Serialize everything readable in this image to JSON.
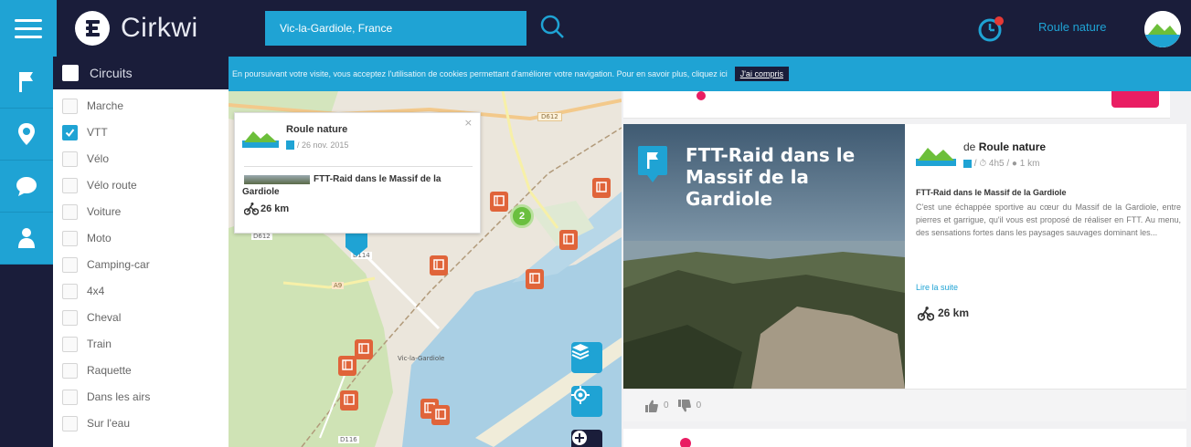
{
  "header": {
    "logo_text": "Cirkwi",
    "search": {
      "value": "Vic-la-Gardiole, France"
    },
    "username": "Roule nature"
  },
  "rail": {
    "items": [
      {
        "icon": "flag-icon"
      },
      {
        "icon": "map-pin-icon"
      },
      {
        "icon": "chat-bubble-icon"
      },
      {
        "icon": "user-icon"
      }
    ]
  },
  "filters": {
    "heading": "Circuits",
    "items": [
      {
        "label": "Marche",
        "checked": false
      },
      {
        "label": "VTT",
        "checked": true
      },
      {
        "label": "Vélo",
        "checked": false
      },
      {
        "label": "Vélo route",
        "checked": false
      },
      {
        "label": "Voiture",
        "checked": false
      },
      {
        "label": "Moto",
        "checked": false
      },
      {
        "label": "Camping-car",
        "checked": false
      },
      {
        "label": "4x4",
        "checked": false
      },
      {
        "label": "Cheval",
        "checked": false
      },
      {
        "label": "Train",
        "checked": false
      },
      {
        "label": "Raquette",
        "checked": false
      },
      {
        "label": "Dans les airs",
        "checked": false
      },
      {
        "label": "Sur l'eau",
        "checked": false
      }
    ]
  },
  "cookie": {
    "text": "En poursuivant votre visite, vous acceptez l'utilisation de cookies permettant d'améliorer votre navigation. Pour en savoir plus, cliquez ici",
    "button": "J'ai compris"
  },
  "map": {
    "cluster_count": "2",
    "place_label": "Vic-la-Gardiole",
    "road_labels": [
      "D612",
      "D114",
      "A9",
      "D612",
      "D116"
    ],
    "popup": {
      "close": "×",
      "author": "Roule nature",
      "date": "/ 26 nov. 2015",
      "title": "FTT-Raid dans le Massif de la Gardiole",
      "distance": "26 km"
    }
  },
  "card": {
    "photo_title": "FTT-Raid dans le Massif de la Gardiole",
    "author_prefix": "de",
    "author": "Roule nature",
    "meta": "/ ⏱ 4h5 / ● 1 km",
    "title": "FTT-Raid dans le Massif de la Gardiole",
    "description": "C'est une échappée sportive au cœur du Massif de la Gardiole, entre pierres et garrigue, qu'il vous est proposé de réaliser en FTT. Au menu, des sensations fortes dans les paysages sauvages dominant les...",
    "read_more": "Lire la suite",
    "distance": "26 km",
    "likes": "0",
    "dislikes": "0"
  },
  "colors": {
    "navy": "#1a1d3a",
    "accent_blue": "#1fa3d4",
    "marker_orange": "#e0643a",
    "pink": "#e91e63"
  }
}
